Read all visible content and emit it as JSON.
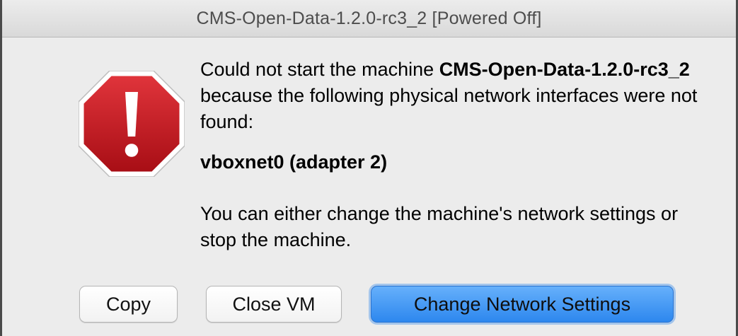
{
  "window": {
    "title": "CMS-Open-Data-1.2.0-rc3_2 [Powered Off]"
  },
  "dialog": {
    "icon": "alert-stop-icon",
    "message": {
      "line1_prefix": "Could not start the machine ",
      "machine_name": "CMS-Open-Data-1.2.0-rc3_2",
      "line1_suffix": " because the following physical network interfaces were not found:",
      "interface": "vboxnet0 (adapter 2)",
      "line3": "You can either change the machine's network settings or stop the machine."
    },
    "buttons": {
      "copy": "Copy",
      "close_vm": "Close VM",
      "change_network": "Change Network Settings"
    }
  },
  "colors": {
    "accent": "#2d87ee",
    "alert_red": "#c8161d"
  }
}
